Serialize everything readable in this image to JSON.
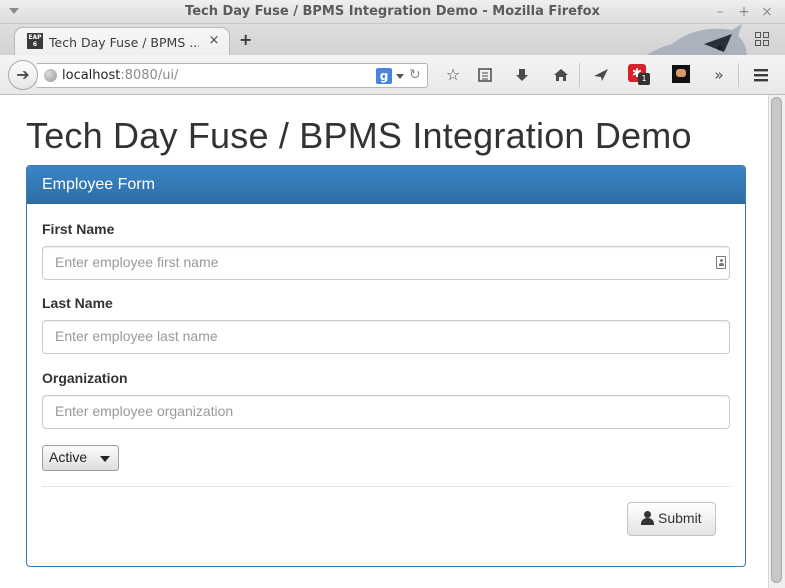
{
  "window": {
    "title": "Tech Day Fuse / BPMS Integration Demo - Mozilla Firefox",
    "minimize_glyph": "–",
    "maximize_glyph": "+",
    "close_glyph": "×"
  },
  "tabs": [
    {
      "label": "Tech Day Fuse / BPMS ...",
      "favicon_text": "EAP 6",
      "close_glyph": "×"
    }
  ],
  "new_tab_glyph": "+",
  "navbar": {
    "url_host": "localhost",
    "url_rest": ":8080/ui/",
    "search_engine_letter": "g",
    "icons": [
      "back-icon",
      "globe-icon",
      "reload-icon",
      "bookmark-star-icon",
      "reader-list-icon",
      "downloads-icon",
      "home-icon",
      "pocket-share-icon",
      "extension-icon",
      "extension-mask-icon",
      "overflow-chevron-icon",
      "hamburger-menu-icon"
    ],
    "extension_badge": "1"
  },
  "page": {
    "title": "Tech Day Fuse / BPMS Integration Demo",
    "panel_heading": "Employee Form",
    "fields": {
      "first_name": {
        "label": "First Name",
        "placeholder": "Enter employee first name"
      },
      "last_name": {
        "label": "Last Name",
        "placeholder": "Enter employee last name"
      },
      "organization": {
        "label": "Organization",
        "placeholder": "Enter employee organization"
      }
    },
    "status_select": {
      "value": "Active"
    },
    "submit_label": "Submit"
  },
  "colors": {
    "panel_primary": "#337ab7",
    "page_background": "#ffffff",
    "text": "#333333",
    "placeholder": "#999999"
  }
}
